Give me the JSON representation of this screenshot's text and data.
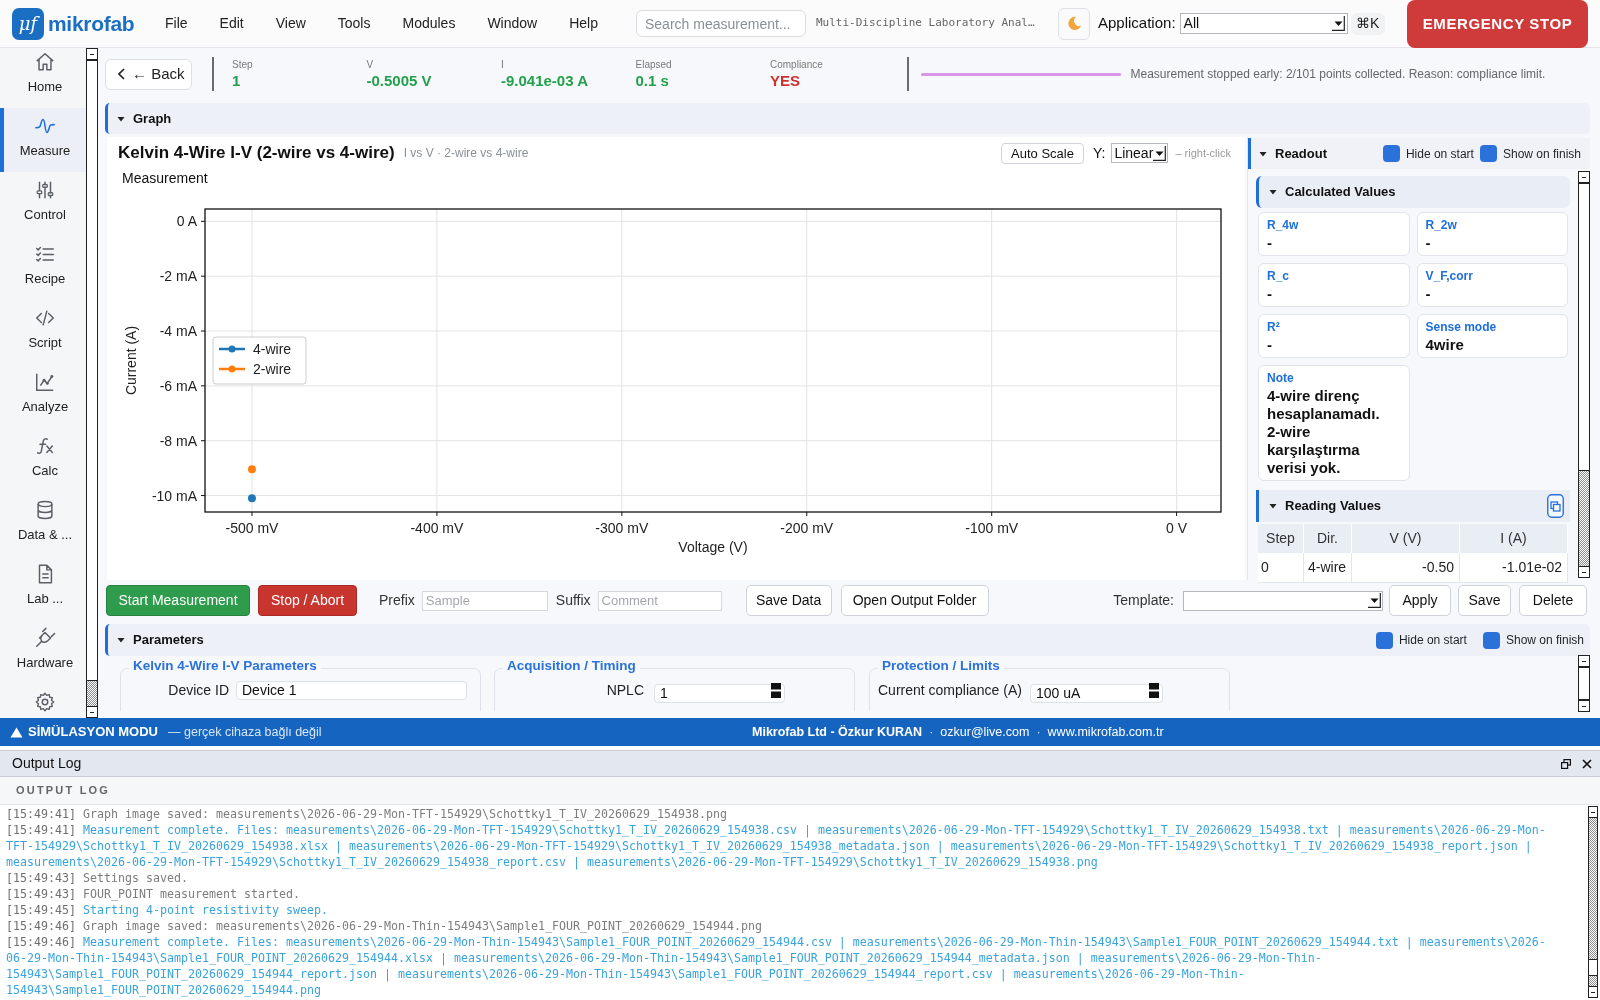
{
  "header": {
    "logo_mark": "μf",
    "brand": "mikrofab",
    "menu": [
      "File",
      "Edit",
      "View",
      "Tools",
      "Modules",
      "Window",
      "Help"
    ],
    "search": {
      "placeholder": "Search measurement..."
    },
    "app_title": "Multi-Discipline Laboratory Anal…",
    "application": {
      "label": "Application:",
      "value": "All"
    },
    "shortcut": "⌘K",
    "emergency_button": "EMERGENCY STOP"
  },
  "sidebar": {
    "items": [
      {
        "label": "Home",
        "selected": false
      },
      {
        "label": "Measure",
        "selected": true
      },
      {
        "label": "Control",
        "selected": false
      },
      {
        "label": "Recipe",
        "selected": false
      },
      {
        "label": "Script",
        "selected": false
      },
      {
        "label": "Analyze",
        "selected": false
      },
      {
        "label": "Calc",
        "selected": false
      },
      {
        "label": "Data & ...",
        "selected": false
      },
      {
        "label": "Lab ...",
        "selected": false
      },
      {
        "label": "Hardware",
        "selected": false
      },
      {
        "selected": false
      }
    ]
  },
  "status": {
    "back_button": "← Back",
    "readings": [
      {
        "label": "Step",
        "value": "1",
        "color": "#22a04b"
      },
      {
        "label": "V",
        "value": "-0.5005 V",
        "color": "#22a04b"
      },
      {
        "label": "I",
        "value": "-9.041e-03 A",
        "color": "#22a04b"
      },
      {
        "label": "Elapsed",
        "value": "0.1 s",
        "color": "#22a04b"
      },
      {
        "label": "Compliance",
        "value": "YES",
        "color": "#d0312d"
      }
    ],
    "progress": {
      "level": 1
    },
    "message": "Measurement stopped early: 2/101 points collected. Reason: compliance limit."
  },
  "graph_section": {
    "title": "Graph",
    "expanded": true
  },
  "graph": {
    "title": "Kelvin 4-Wire I-V (2-wire vs 4-wire)",
    "subtitle": "I vs V · 2-wire vs 4-wire",
    "auto_scale_button": "Auto Scale",
    "y_scale": {
      "label": "Y:",
      "value": "Linear"
    },
    "hint": "– right-click",
    "chart_data": {
      "type": "scatter",
      "title": "Measurement",
      "xlabel": "Voltage (V)",
      "ylabel": "Current (A)",
      "xlim": [
        -525.4,
        24
      ],
      "ylim": [
        -10.6,
        0.45
      ],
      "xticks": [
        {
          "value": -500,
          "label": "-500 mV"
        },
        {
          "value": -400,
          "label": "-400 mV"
        },
        {
          "value": -300,
          "label": "-300 mV"
        },
        {
          "value": -200,
          "label": "-200 mV"
        },
        {
          "value": -100,
          "label": "-100 mV"
        },
        {
          "value": 0,
          "label": "0 V"
        }
      ],
      "yticks": [
        {
          "value": 0,
          "label": "0 A"
        },
        {
          "value": -2,
          "label": "-2 mA"
        },
        {
          "value": -4,
          "label": "-4 mA"
        },
        {
          "value": -6,
          "label": "-6 mA"
        },
        {
          "value": -8,
          "label": "-8 mA"
        },
        {
          "value": -10,
          "label": "-10 mA"
        }
      ],
      "grid": true,
      "legend": "center left",
      "series": [
        {
          "name": "4-wire",
          "color": "#1f77b4",
          "x": [
            -500
          ],
          "values": [
            -10.1
          ]
        },
        {
          "name": "2-wire",
          "color": "#ff7f0e",
          "x": [
            -500
          ],
          "values": [
            -9.04
          ]
        }
      ]
    }
  },
  "readout": {
    "title": "Readout",
    "expanded": true,
    "toggles": [
      {
        "label": "Hide on start",
        "checked": true
      },
      {
        "label": "Show on finish",
        "checked": true
      }
    ],
    "calculated": {
      "title": "Calculated Values",
      "expanded": true,
      "cards": [
        {
          "label": "R_4w",
          "value": "-"
        },
        {
          "label": "R_2w",
          "value": "-"
        },
        {
          "label": "R_c",
          "value": "-"
        },
        {
          "label": "V_F,corr",
          "value": "-"
        },
        {
          "label": "R²",
          "value": "-"
        },
        {
          "label": "Sense mode",
          "value": "4wire"
        },
        {
          "label": "Note",
          "value": "4-wire direnç hesaplanamadı. 2-wire karşılaştırma verisi yok."
        }
      ]
    },
    "reading_values": {
      "title": "Reading Values",
      "expanded": true,
      "columns": [
        "Step",
        "Dir.",
        "V (V)",
        "I (A)"
      ],
      "rows": [
        [
          "0",
          "4-wire",
          "-0.50",
          "-1.01e-02"
        ]
      ]
    }
  },
  "toolbar": {
    "start_button": "Start Measurement",
    "stop_button": "Stop / Abort",
    "prefix": {
      "label": "Prefix",
      "placeholder": "Sample"
    },
    "suffix": {
      "label": "Suffix",
      "placeholder": "Comment"
    },
    "save_data_button": "Save Data",
    "open_folder_button": "Open Output Folder",
    "template": {
      "label": "Template:"
    },
    "buttons": [
      "Apply",
      "Save",
      "Delete"
    ]
  },
  "parameters": {
    "title": "Parameters",
    "expanded": true,
    "toggles": [
      {
        "label": "Hide on start",
        "checked": true
      },
      {
        "label": "Show on finish",
        "checked": true
      }
    ],
    "groups": [
      {
        "title": "Kelvin 4-Wire I-V Parameters",
        "fields": [
          {
            "label": "Device ID",
            "value": "Device 1",
            "kind": "text"
          }
        ]
      },
      {
        "title": "Acquisition / Timing",
        "fields": [
          {
            "label": "NPLC",
            "value": "1",
            "kind": "spin"
          }
        ]
      },
      {
        "title": "Protection / Limits",
        "fields": [
          {
            "label": "Current compliance (A)",
            "value": "100 uA",
            "kind": "spin"
          }
        ]
      }
    ]
  },
  "status_bar": {
    "mode": "SİMÜLASYON MODU",
    "mode_note": "— gerçek cihaza bağlı değil",
    "credits": [
      {
        "kind": "name",
        "text": "Mikrofab Ltd - Özkur KURAN"
      },
      {
        "kind": "separator",
        "text": "·"
      },
      {
        "kind": "email",
        "text": "ozkur@live.com"
      },
      {
        "kind": "separator",
        "text": "·"
      },
      {
        "kind": "website",
        "text": "www.mikrofab.com.tr"
      }
    ]
  },
  "output_log": {
    "dock_title": "Output Log",
    "header": "OUTPUT LOG",
    "entries": [
      {
        "time": "[15:49:41]",
        "message": "Graph image saved: measurements\\2026-06-29-Mon-TFT-154929\\Schottky1_T_IV_20260629_154938.png",
        "color": "#7d7d7d"
      },
      {
        "time": "[15:49:41]",
        "message": "Measurement complete. Files: measurements\\2026-06-29-Mon-TFT-154929\\Schottky1_T_IV_20260629_154938.csv | measurements\\2026-06-29-Mon-TFT-154929\\Schottky1_T_IV_20260629_154938.txt | measurements\\2026-06-29-Mon-TFT-154929\\Schottky1_T_IV_20260629_154938.xlsx | measurements\\2026-06-29-Mon-TFT-154929\\Schottky1_T_IV_20260629_154938_metadata.json | measurements\\2026-06-29-Mon-TFT-154929\\Schottky1_T_IV_20260629_154938_report.json | measurements\\2026-06-29-Mon-TFT-154929\\Schottky1_T_IV_20260629_154938_report.csv | measurements\\2026-06-29-Mon-TFT-154929\\Schottky1_T_IV_20260629_154938.png",
        "color": "#3aa3dc"
      },
      {
        "time": "[15:49:43]",
        "message": "Settings saved.",
        "color": "#7d7d7d"
      },
      {
        "time": "[15:49:43]",
        "message": "FOUR_POINT measurement started.",
        "color": "#7d7d7d"
      },
      {
        "time": "[15:49:45]",
        "message": "Starting 4-point resistivity sweep.",
        "color": "#3aa3dc"
      },
      {
        "time": "[15:49:46]",
        "message": "Graph image saved: measurements\\2026-06-29-Mon-Thin-154943\\Sample1_FOUR_POINT_20260629_154944.png",
        "color": "#7d7d7d"
      },
      {
        "time": "[15:49:46]",
        "message": "Measurement complete. Files: measurements\\2026-06-29-Mon-Thin-154943\\Sample1_FOUR_POINT_20260629_154944.csv | measurements\\2026-06-29-Mon-Thin-154943\\Sample1_FOUR_POINT_20260629_154944.txt | measurements\\2026-06-29-Mon-Thin-154943\\Sample1_FOUR_POINT_20260629_154944.xlsx | measurements\\2026-06-29-Mon-Thin-154943\\Sample1_FOUR_POINT_20260629_154944_metadata.json | measurements\\2026-06-29-Mon-Thin-154943\\Sample1_FOUR_POINT_20260629_154944_report.json | measurements\\2026-06-29-Mon-Thin-154943\\Sample1_FOUR_POINT_20260629_154944_report.csv | measurements\\2026-06-29-Mon-Thin-154943\\Sample1_FOUR_POINT_20260629_154944.png",
        "color": "#3aa3dc"
      }
    ]
  }
}
